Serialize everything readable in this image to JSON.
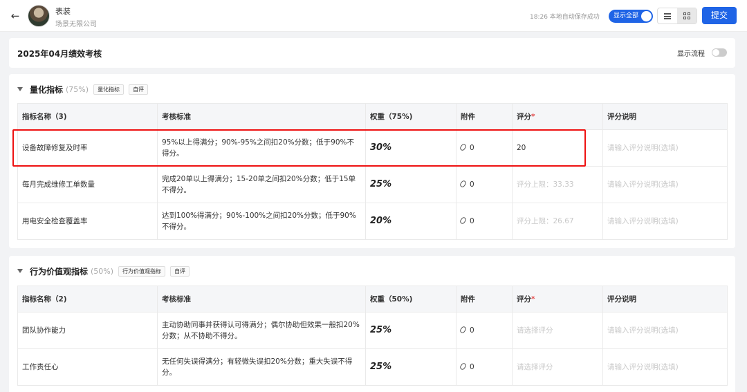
{
  "header": {
    "user_name": "表装",
    "company": "场景无限公司",
    "save_status": "18:26 本地自动保存成功",
    "show_all_label": "显示全部",
    "submit_label": "提交"
  },
  "page": {
    "title": "2025年04月绩效考核",
    "flow_label": "显示流程"
  },
  "sections": [
    {
      "title": "量化指标",
      "pct": "(75%)",
      "tags": [
        "量化指标",
        "自评"
      ],
      "columns": [
        "指标名称（3)",
        "考核标准",
        "权重（75%)",
        "附件",
        "评分",
        "评分说明"
      ],
      "rows": [
        {
          "name": "设备故障修复及时率",
          "standard": "95%以上得满分；90%-95%之间扣20%分数；低于90%不得分。",
          "weight": "30%",
          "attach": "0",
          "score": "20",
          "note": "请输入评分说明(选填)"
        },
        {
          "name": "每月完成维修工单数量",
          "standard": "完成20单以上得满分；15-20单之间扣20%分数；低于15单不得分。",
          "weight": "25%",
          "attach": "0",
          "score": "评分上限：33.33",
          "note": "请输入评分说明(选填)"
        },
        {
          "name": "用电安全检查覆盖率",
          "standard": "达到100%得满分；90%-100%之间扣20%分数；低于90%不得分。",
          "weight": "20%",
          "attach": "0",
          "score": "评分上限：26.67",
          "note": "请输入评分说明(选填)"
        }
      ]
    },
    {
      "title": "行为价值观指标",
      "pct": "(50%)",
      "tags": [
        "行为价值观指标",
        "自评"
      ],
      "columns": [
        "指标名称（2)",
        "考核标准",
        "权重（50%)",
        "附件",
        "评分",
        "评分说明"
      ],
      "rows": [
        {
          "name": "团队协作能力",
          "standard": "主动协助同事并获得认可得满分；偶尔协助但效果一般扣20%分数；从不协助不得分。",
          "weight": "25%",
          "attach": "0",
          "score": "请选择评分",
          "note": "请输入评分说明(选填)"
        },
        {
          "name": "工作责任心",
          "standard": "无任何失误得满分；有轻微失误扣20%分数；重大失误不得分。",
          "weight": "25%",
          "attach": "0",
          "score": "请选择评分",
          "note": "请输入评分说明(选填)"
        }
      ]
    }
  ],
  "required_mark": "*",
  "colors": {
    "primary": "#1f64e6",
    "highlight": "#e11111"
  },
  "icons": [
    "back-arrow-icon",
    "list-view-icon",
    "grid-view-icon",
    "caret-down-icon",
    "paperclip-icon"
  ]
}
